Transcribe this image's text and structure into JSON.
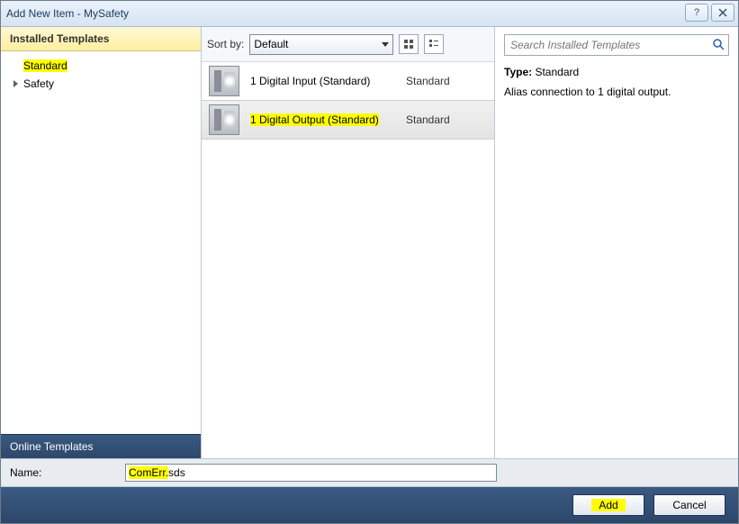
{
  "title": "Add New Item - MySafety",
  "sidebar": {
    "header": "Installed Templates",
    "items": [
      {
        "label": "Standard",
        "highlight": true,
        "hasChild": false
      },
      {
        "label": "Safety",
        "highlight": false,
        "hasChild": true
      }
    ],
    "footer": "Online Templates"
  },
  "toolbar": {
    "sort_label": "Sort by:",
    "sort_value": "Default"
  },
  "list": [
    {
      "name": "1 Digital Input (Standard)",
      "kind": "Standard",
      "selected": false,
      "highlight": false
    },
    {
      "name": "1 Digital Output (Standard)",
      "kind": "Standard",
      "selected": true,
      "highlight": true
    }
  ],
  "search": {
    "placeholder": "Search Installed Templates"
  },
  "details": {
    "type_label": "Type:",
    "type_value": "Standard",
    "description": "Alias connection to 1 digital output."
  },
  "name_row": {
    "label": "Name:",
    "value_hl": "ComErr.",
    "value_rest": "sds"
  },
  "buttons": {
    "add": "Add",
    "cancel": "Cancel"
  }
}
